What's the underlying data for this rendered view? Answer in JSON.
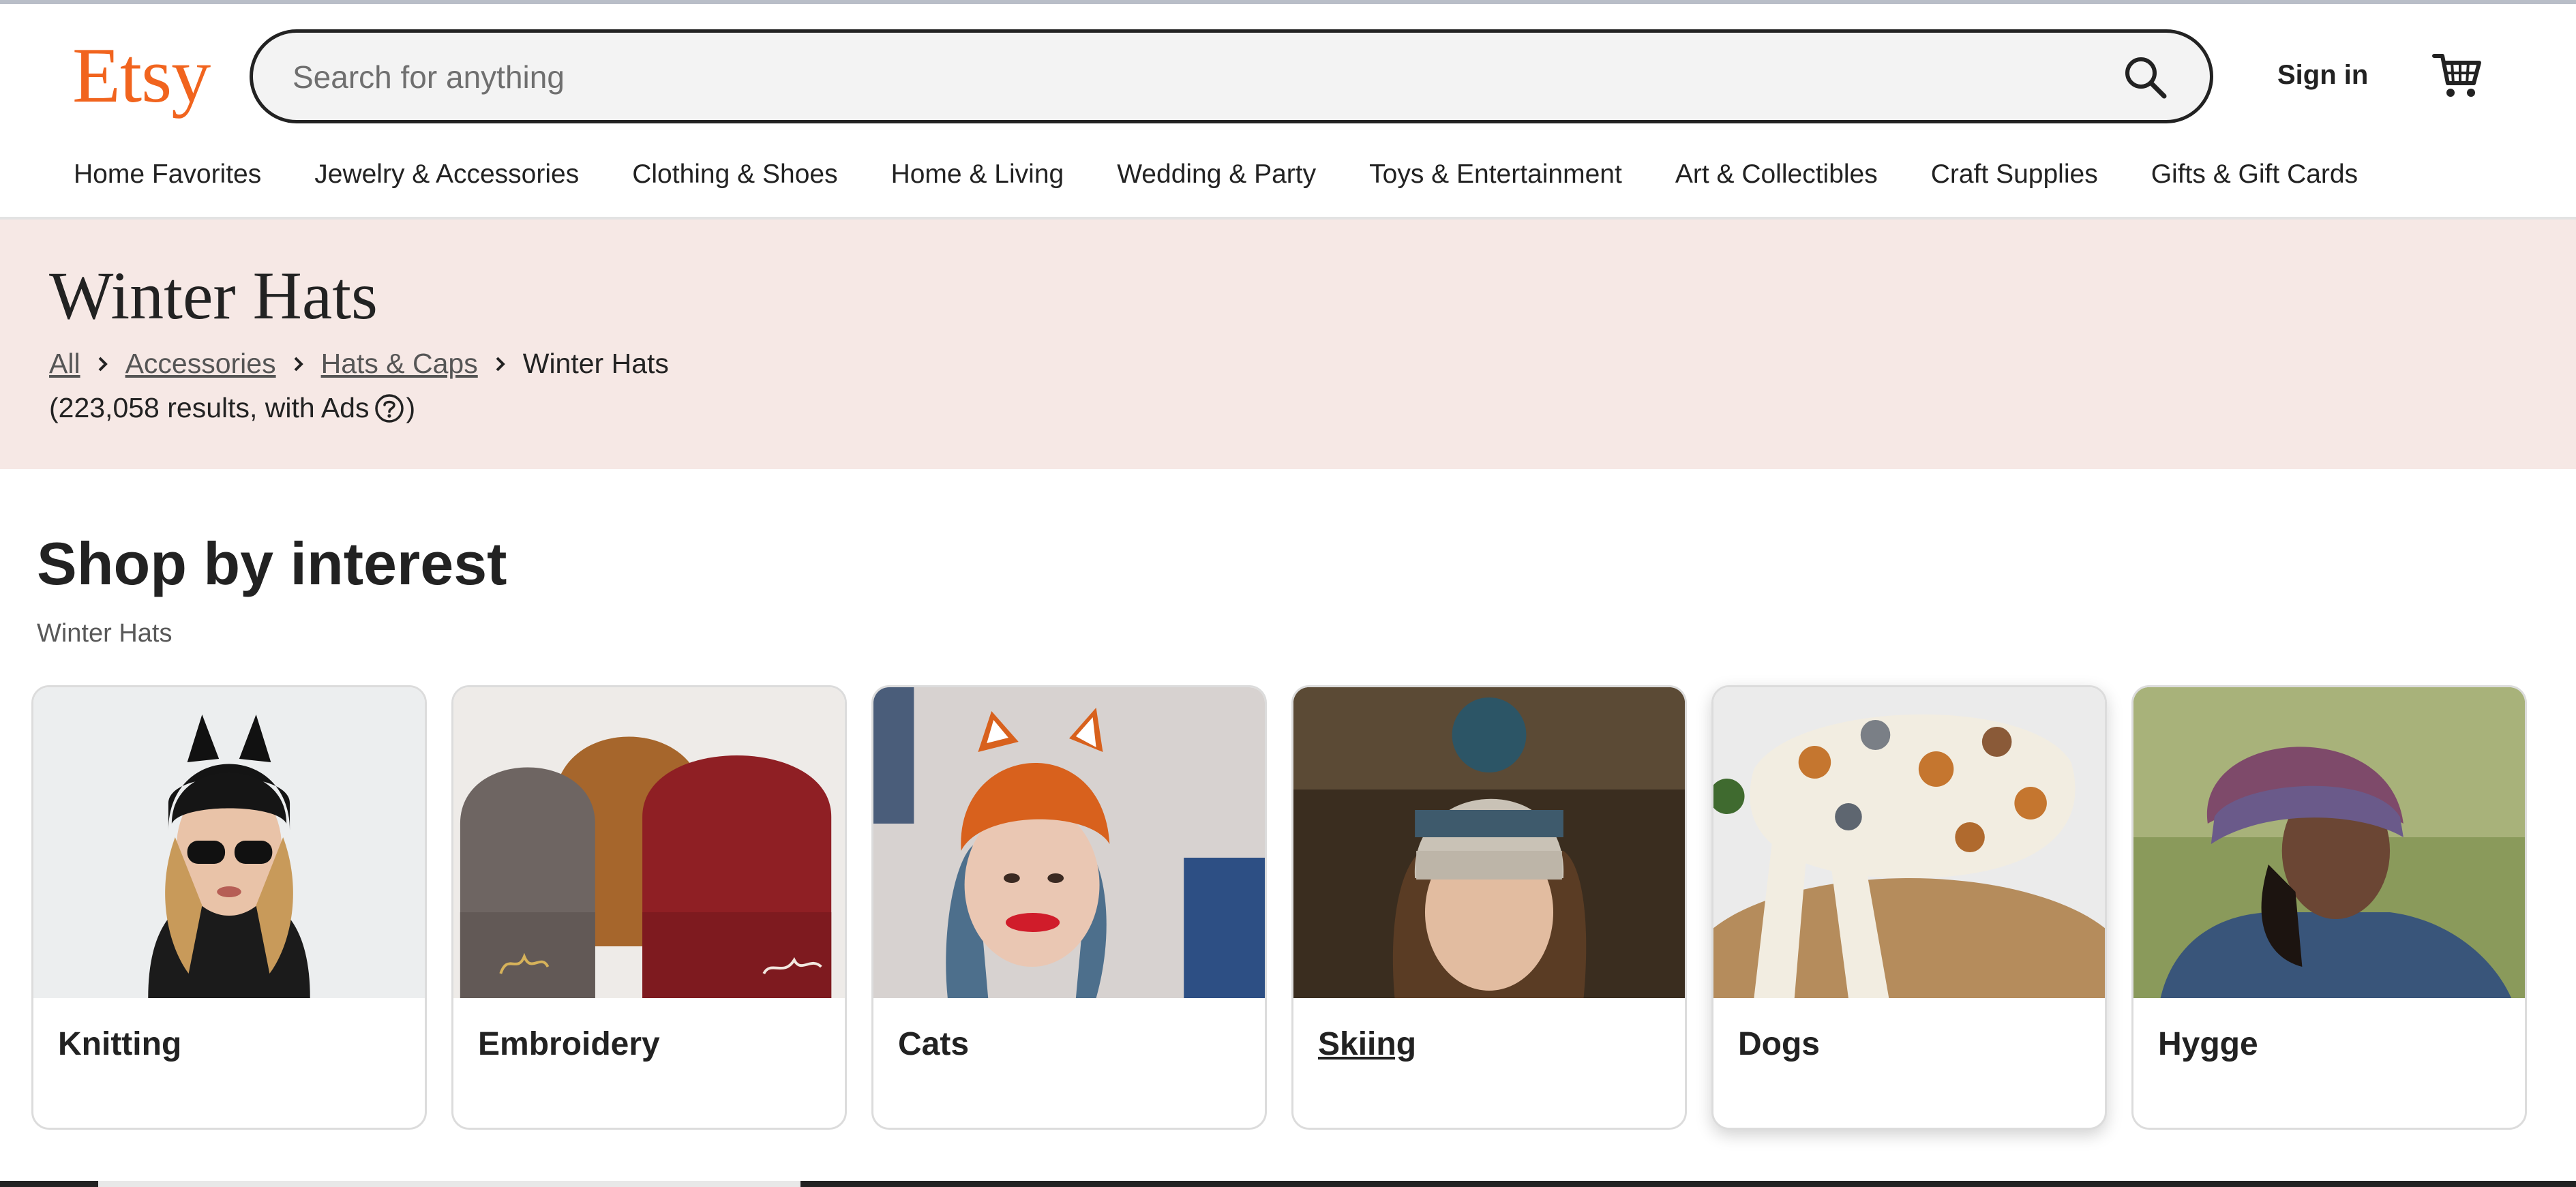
{
  "header": {
    "logo_text": "Etsy",
    "search_placeholder": "Search for anything",
    "sign_in_label": "Sign in",
    "icons": {
      "search": "search-icon",
      "cart": "cart-icon"
    }
  },
  "category_nav": [
    "Home Favorites",
    "Jewelry & Accessories",
    "Clothing & Shoes",
    "Home & Living",
    "Wedding & Party",
    "Toys & Entertainment",
    "Art & Collectibles",
    "Craft Supplies",
    "Gifts & Gift Cards"
  ],
  "banner": {
    "title": "Winter Hats",
    "breadcrumb": [
      "All",
      "Accessories",
      "Hats & Caps",
      "Winter Hats"
    ],
    "results_text": "(223,058 results, with Ads",
    "results_close": ")"
  },
  "interest": {
    "title": "Shop by interest",
    "subtitle": "Winter Hats",
    "cards": [
      {
        "label": "Knitting"
      },
      {
        "label": "Embroidery"
      },
      {
        "label": "Cats"
      },
      {
        "label": "Skiing"
      },
      {
        "label": "Dogs"
      },
      {
        "label": "Hygge"
      }
    ]
  },
  "colors": {
    "brand": "#f1641e",
    "banner_bg": "#f6e8e5",
    "text": "#222222"
  }
}
